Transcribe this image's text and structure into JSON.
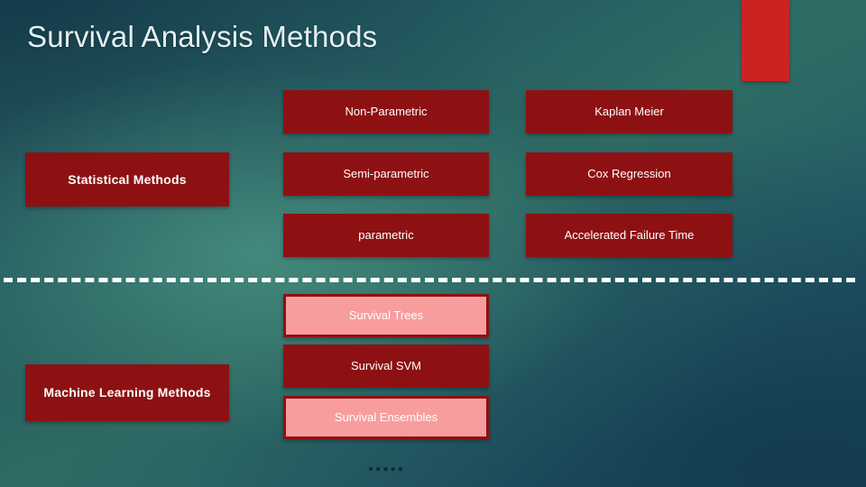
{
  "slide": {
    "title": "Survival Analysis Methods",
    "ellipsis": ".....",
    "colors": {
      "box_dark_red": "#8d1113",
      "box_pink": "#f79d9d",
      "accent_red": "#cb2222",
      "title_text": "#e4f0f2",
      "divider": "#ffffff",
      "background_teal_light": "#2f6d64",
      "background_teal_dark": "#17465a"
    }
  },
  "accent": {
    "name": "red-accent-rectangle"
  },
  "groups": [
    {
      "category": "Statistical Methods",
      "methods": [
        {
          "label": "Non-Parametric",
          "style": "dark"
        },
        {
          "label": "Semi-parametric",
          "style": "dark"
        },
        {
          "label": "parametric",
          "style": "dark"
        }
      ],
      "examples": [
        {
          "label": "Kaplan Meier",
          "style": "dark"
        },
        {
          "label": "Cox Regression",
          "style": "dark"
        },
        {
          "label": "Accelerated Failure Time",
          "style": "dark"
        }
      ]
    },
    {
      "category": "Machine Learning Methods",
      "methods": [
        {
          "label": "Survival Trees",
          "style": "pink"
        },
        {
          "label": "Survival SVM",
          "style": "dark"
        },
        {
          "label": "Survival Ensembles",
          "style": "pink"
        }
      ],
      "examples": []
    }
  ]
}
